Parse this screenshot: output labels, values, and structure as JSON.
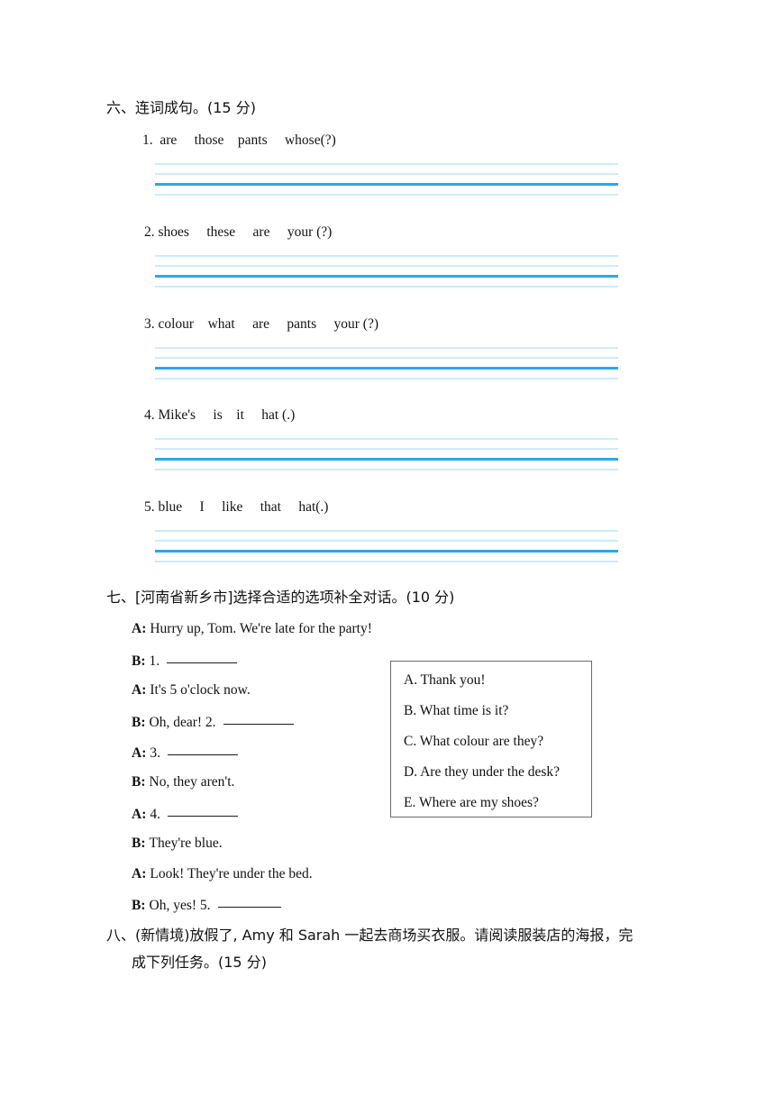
{
  "sections": [
    {
      "id": "section-six",
      "heading": "六、连词成句。(15 分)",
      "items": [
        {
          "number": "1.",
          "text": "1.  are     those    pants     whose(?)"
        },
        {
          "number": "2.",
          "text": "2. shoes     these     are     your (?)"
        },
        {
          "number": "3.",
          "text": "3. colour    what     are     pants     your (?)"
        },
        {
          "number": "4.",
          "text": "4. Mike's     is    it     hat (.)"
        },
        {
          "number": "5.",
          "text": "5. blue     I     like     that     hat(.)"
        }
      ]
    },
    {
      "id": "section-seven",
      "heading": "七、[河南省新乡市]选择合适的选项补全对话。(10 分)",
      "dialogue": [
        {
          "speaker": "A:",
          "text": "Hurry up, Tom. We're late for the party!",
          "blank": false
        },
        {
          "speaker": "B:",
          "text": "1.",
          "blank": true
        },
        {
          "speaker": "A:",
          "text": "It's 5 o'clock now.",
          "blank": false
        },
        {
          "speaker": "B:",
          "text": "Oh, dear! 2.",
          "blank": true
        },
        {
          "speaker": "A:",
          "text": "3.",
          "blank": true
        },
        {
          "speaker": "B:",
          "text": "No, they aren't.",
          "blank": false
        },
        {
          "speaker": "A:",
          "text": "4.",
          "blank": true
        },
        {
          "speaker": "B:",
          "text": "They're blue.",
          "blank": false
        },
        {
          "speaker": "A:",
          "text": "Look! They're under the bed.",
          "blank": false
        },
        {
          "speaker": "B:",
          "text": "Oh, yes! 5.",
          "blank": true
        }
      ],
      "options": [
        "A. Thank you!",
        "B. What time is it?",
        "C. What colour are they?",
        "D. Are they under the desk?",
        "E. Where are my shoes?"
      ]
    },
    {
      "id": "section-eight",
      "heading_line1": "八、(新情境)放假了, Amy 和 Sarah 一起去商场买衣服。请阅读服装店的海报，完",
      "heading_line2": "成下列任务。(15 分)"
    }
  ],
  "colors": {
    "rule_light": "#cdebfb",
    "rule_accent": "#29a9e8",
    "text": "#121212",
    "box_border": "#6a6a6a"
  }
}
